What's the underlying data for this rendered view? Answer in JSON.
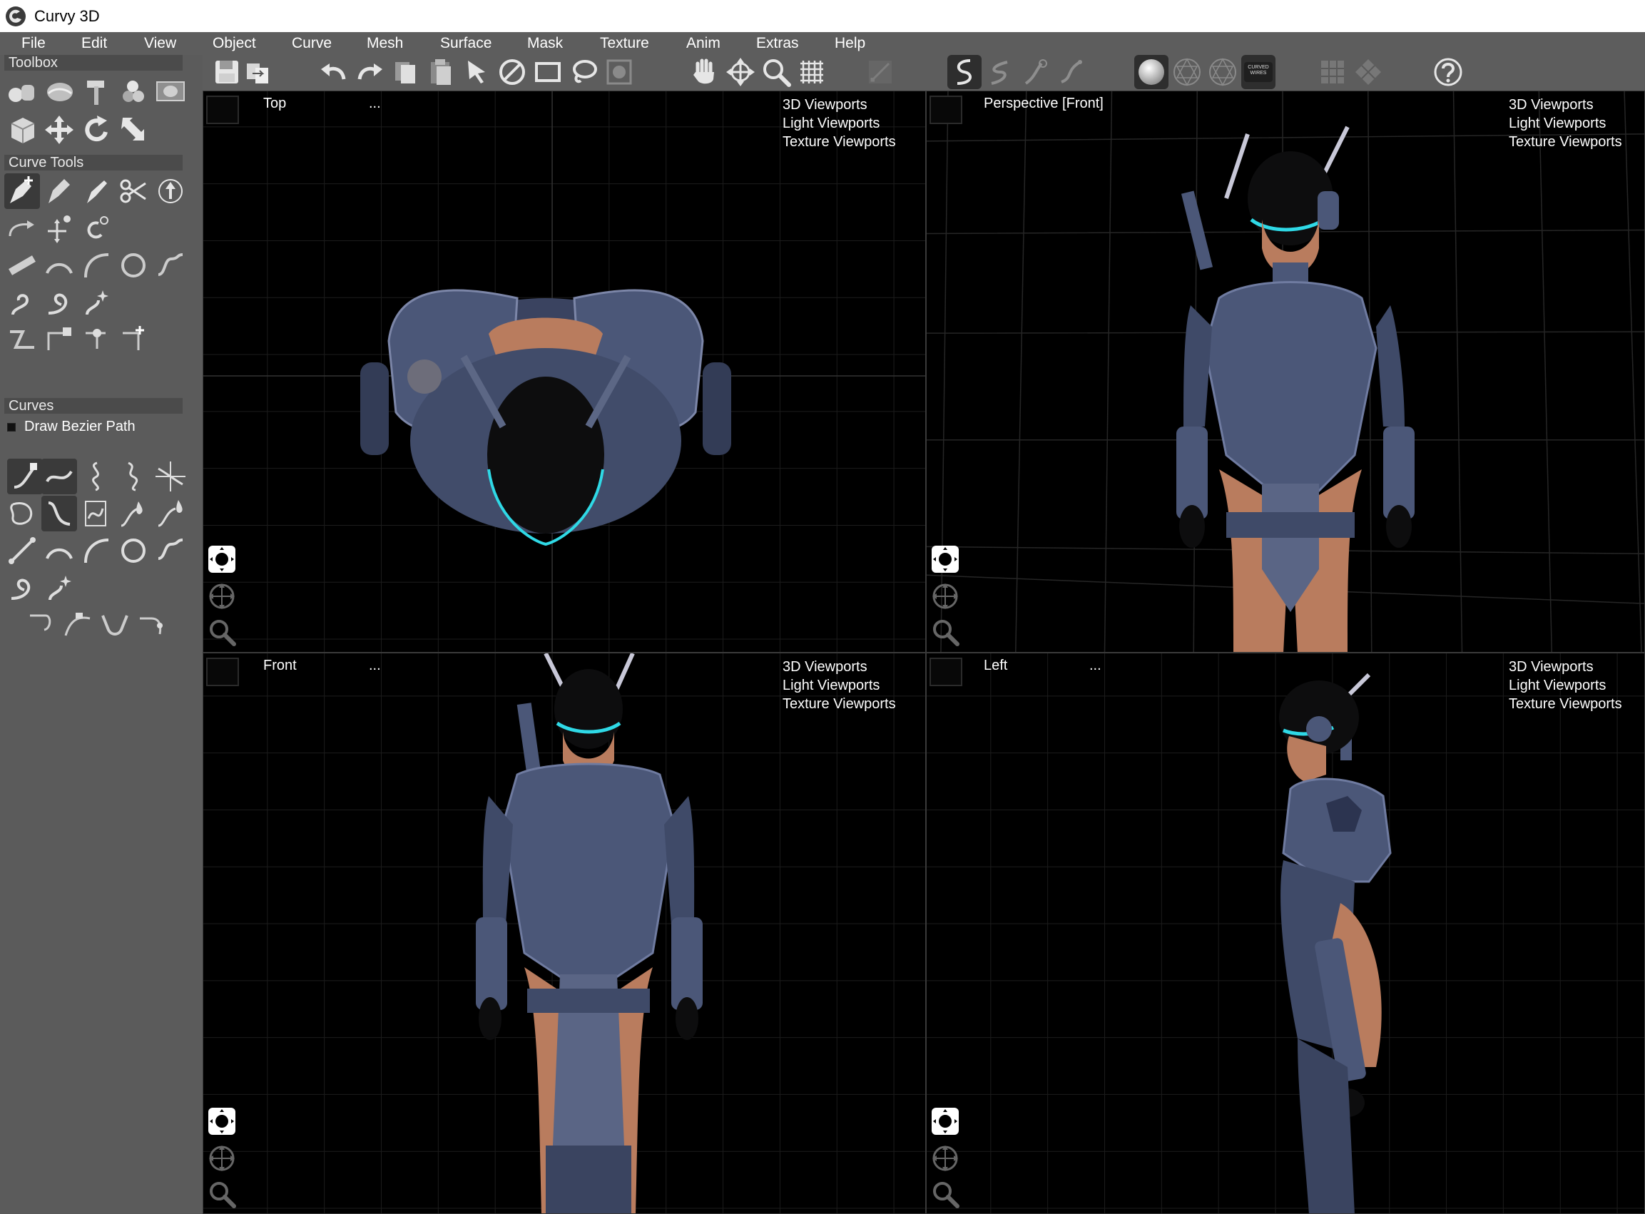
{
  "app": {
    "title": "Curvy 3D",
    "logo_icon": "curvy-logo-icon"
  },
  "menu": [
    "File",
    "Edit",
    "View",
    "Object",
    "Curve",
    "Mesh",
    "Surface",
    "Mask",
    "Texture",
    "Anim",
    "Extras",
    "Help"
  ],
  "toolbar": {
    "curved_wires_label": "CURVED WIRES",
    "icons": [
      "save-icon",
      "export-icon",
      "undo-icon",
      "redo-icon",
      "copy-icon",
      "paste-icon",
      "select-arrow-icon",
      "deselect-icon",
      "rectangle-select-icon",
      "lasso-select-icon",
      "circle-select-icon",
      "pan-hand-icon",
      "move-view-icon",
      "zoom-icon",
      "grid-icon",
      "edit-disabled-icon",
      "curve-draw-icon",
      "curve-smooth-icon",
      "curve-point-icon",
      "curve-extend-icon",
      "shaded-sphere-icon",
      "wireframe-sphere-icon",
      "hidden-wire-sphere-icon",
      "curved-wires-icon",
      "single-view-icon",
      "quad-view-icon",
      "help-icon"
    ]
  },
  "left_panel": {
    "toolbox_header": "Toolbox",
    "curve_tools_header": "Curve Tools",
    "curves_header": "Curves",
    "curve_item": "Draw Bezier Path"
  },
  "viewports": {
    "menu_items": [
      "3D Viewports",
      "Light Viewports",
      "Texture Viewports"
    ],
    "dots": "...",
    "top_label": "Top",
    "perspective_label": "Perspective [Front]",
    "front_label": "Front",
    "left_label": "Left"
  },
  "colors": {
    "panel_bg": "#5b5b5b",
    "armor": "#4b5778",
    "visor_glow": "#2fd9e6",
    "skin": "#b97c5e"
  }
}
